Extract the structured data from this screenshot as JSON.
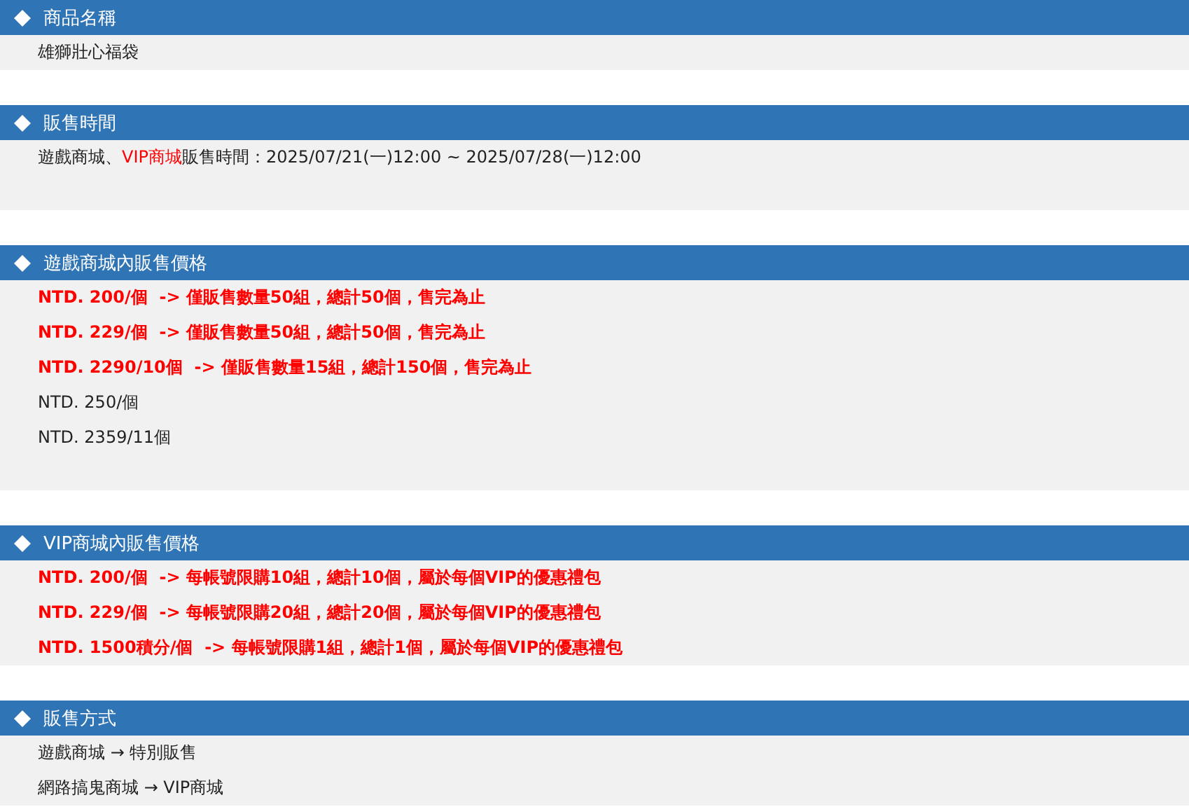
{
  "sections": [
    {
      "title": "商品名稱",
      "lines": [
        [
          {
            "text": "雄獅壯心福袋",
            "kind": "plain"
          }
        ]
      ]
    },
    {
      "title": "販售時間",
      "lines": [
        [
          {
            "text": "遊戲商城、",
            "kind": "plain"
          },
          {
            "text": "VIP商城",
            "kind": "red"
          },
          {
            "text": "販售時間：2025/07/21(一)12:00 ~ 2025/07/28(一)12:00",
            "kind": "plain"
          }
        ]
      ]
    },
    {
      "title": "遊戲商城內販售價格",
      "lines": [
        [
          {
            "text": "NTD. 200/個  -> 僅販售數量50組，總計50個，售完為止",
            "kind": "red_bold"
          }
        ],
        [
          {
            "text": "NTD. 229/個  -> 僅販售數量50組，總計50個，售完為止",
            "kind": "red_bold"
          }
        ],
        [
          {
            "text": "NTD. 2290/10個  -> 僅販售數量15組，總計150個，售完為止",
            "kind": "red_bold"
          }
        ],
        [
          {
            "text": "NTD. 250/個",
            "kind": "plain"
          }
        ],
        [
          {
            "text": "NTD. 2359/11個",
            "kind": "plain"
          }
        ]
      ]
    },
    {
      "title": "VIP商城內販售價格",
      "lines": [
        [
          {
            "text": "NTD. 200/個  -> 每帳號限購10組，總計10個，屬於每個VIP的優惠禮包",
            "kind": "red_bold"
          }
        ],
        [
          {
            "text": "NTD. 229/個  -> 每帳號限購20組，總計20個，屬於每個VIP的優惠禮包",
            "kind": "red_bold"
          }
        ],
        [
          {
            "text": "NTD. 1500積分/個  -> 每帳號限購1組，總計1個，屬於每個VIP的優惠禮包",
            "kind": "red_bold"
          }
        ]
      ]
    },
    {
      "title": "販售方式",
      "lines": [
        [
          {
            "text": "遊戲商城 → 特別販售",
            "kind": "plain"
          }
        ],
        [
          {
            "text": "網路搞鬼商城 → VIP商城",
            "kind": "plain"
          }
        ]
      ]
    }
  ]
}
